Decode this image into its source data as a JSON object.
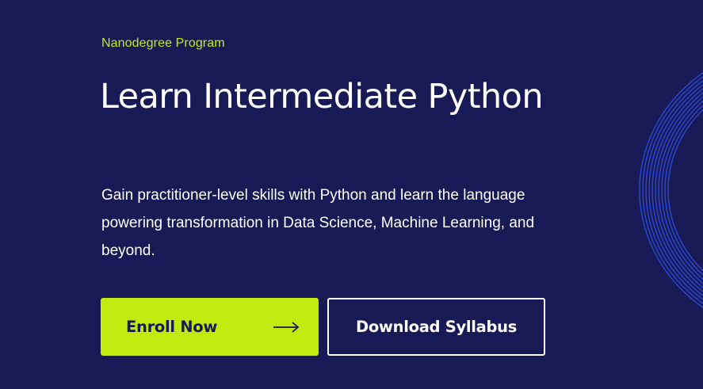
{
  "hero": {
    "eyebrow": "Nanodegree Program",
    "title": "Learn Intermediate Python",
    "description": "Gain practitioner-level skills with Python and learn the language powering transformation in Data Science, Machine Learning, and beyond."
  },
  "buttons": {
    "enroll_label": "Enroll Now",
    "download_label": "Download Syllabus"
  },
  "icons": {
    "enroll_arrow": "arrow-right-icon",
    "decoration": "concentric-arcs-decoration"
  },
  "colors": {
    "background": "#171a55",
    "accent": "#c2ea0f",
    "text": "#ffffff",
    "decoration": "#2d48d8"
  }
}
